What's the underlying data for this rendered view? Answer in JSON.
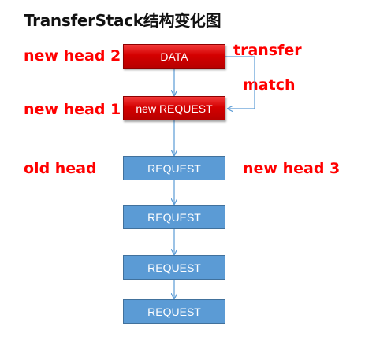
{
  "title": "TransferStack结构变化图",
  "labels": {
    "new_head_2": "new head 2",
    "new_head_1": "new head 1",
    "old_head": "old head",
    "new_head_3": "new head 3",
    "transfer": "transfer",
    "match": "match"
  },
  "nodes": [
    {
      "label": "DATA",
      "color": "#d40000"
    },
    {
      "label": "new REQUEST",
      "color": "#d40000"
    },
    {
      "label": "REQUEST",
      "color": "#5b9bd5"
    },
    {
      "label": "REQUEST",
      "color": "#5b9bd5"
    },
    {
      "label": "REQUEST",
      "color": "#5b9bd5"
    },
    {
      "label": "REQUEST",
      "color": "#5b9bd5"
    }
  ]
}
